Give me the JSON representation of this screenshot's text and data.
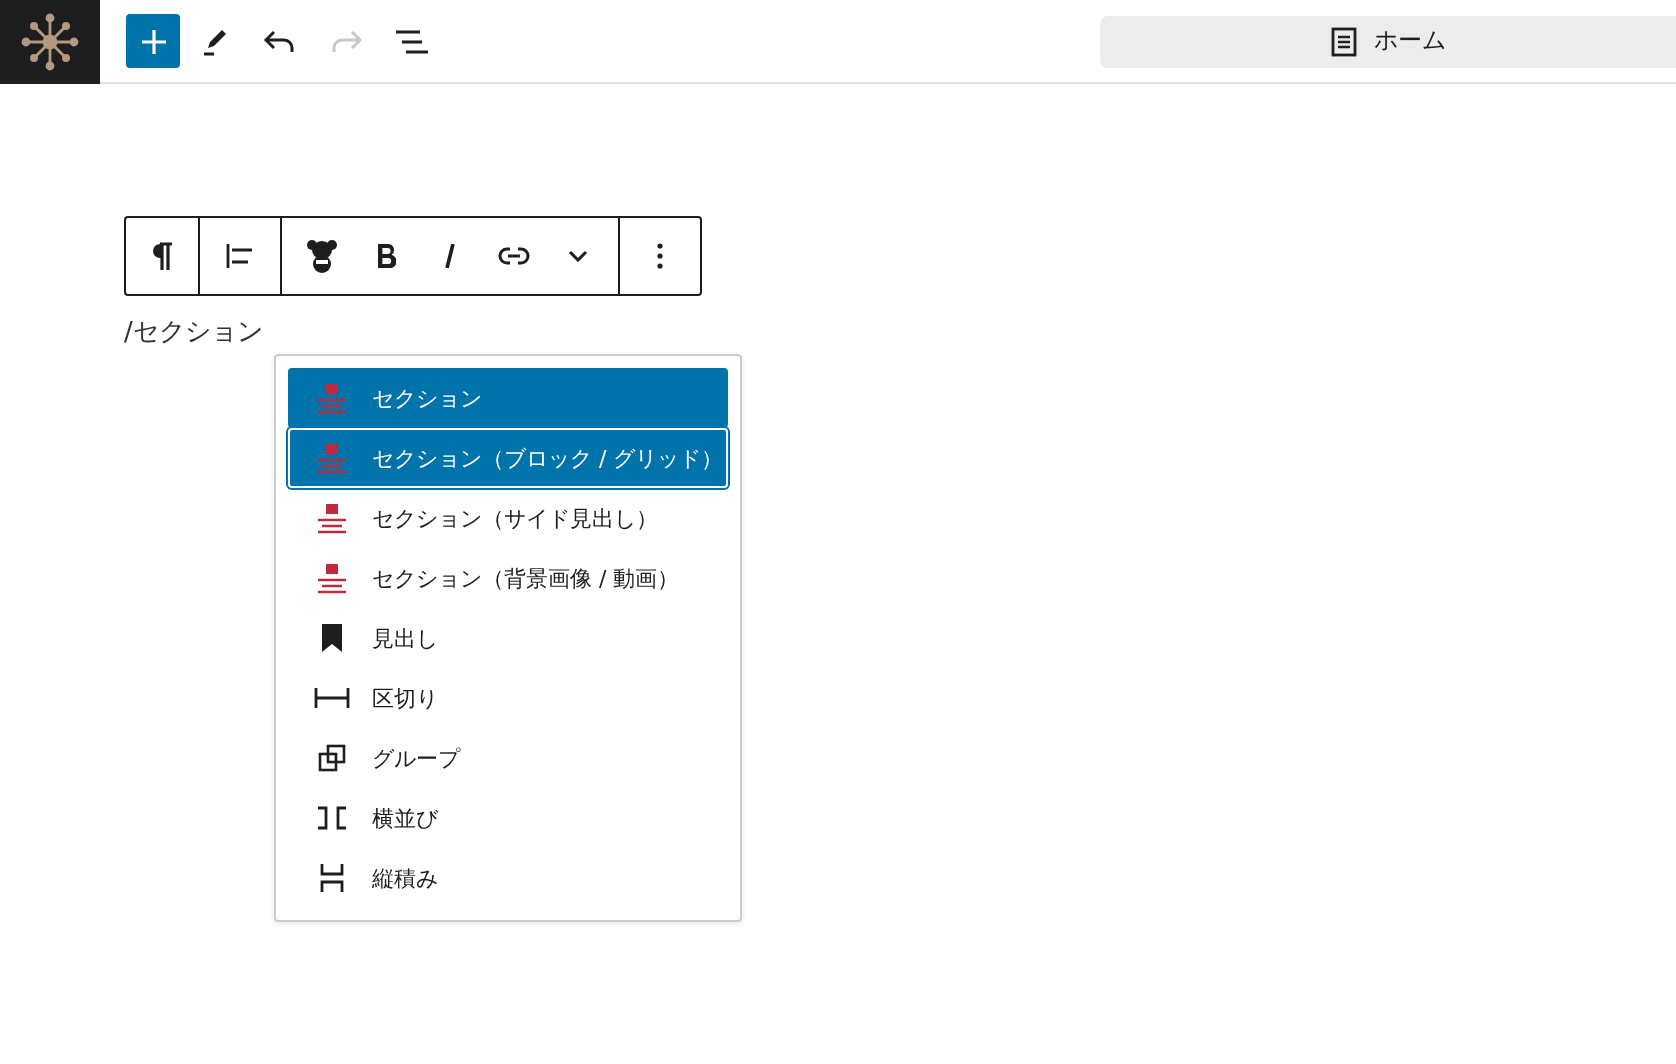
{
  "top_toolbar": {
    "redo_disabled": true
  },
  "document_bar": {
    "title": "ホーム"
  },
  "block_toolbar": {
    "buttons": [
      {
        "kind": "paragraph"
      },
      {
        "kind": "align"
      },
      {
        "kind": "custom"
      },
      {
        "kind": "bold"
      },
      {
        "kind": "italic"
      },
      {
        "kind": "link"
      },
      {
        "kind": "more"
      },
      {
        "kind": "options"
      }
    ]
  },
  "editor": {
    "text": "/セクション"
  },
  "suggestions": [
    {
      "label": "セクション",
      "kind": "section",
      "selected": true,
      "focused": false
    },
    {
      "label": "セクション（ブロック / グリッド）",
      "kind": "section",
      "selected": true,
      "focused": true
    },
    {
      "label": "セクション（サイド見出し）",
      "kind": "section",
      "selected": false,
      "focused": false
    },
    {
      "label": "セクション（背景画像 / 動画）",
      "kind": "section",
      "selected": false,
      "focused": false
    },
    {
      "label": "見出し",
      "kind": "heading",
      "selected": false,
      "focused": false
    },
    {
      "label": "区切り",
      "kind": "separator",
      "selected": false,
      "focused": false
    },
    {
      "label": "グループ",
      "kind": "group",
      "selected": false,
      "focused": false
    },
    {
      "label": "横並び",
      "kind": "row",
      "selected": false,
      "focused": false
    },
    {
      "label": "縦積み",
      "kind": "stack",
      "selected": false,
      "focused": false
    }
  ]
}
